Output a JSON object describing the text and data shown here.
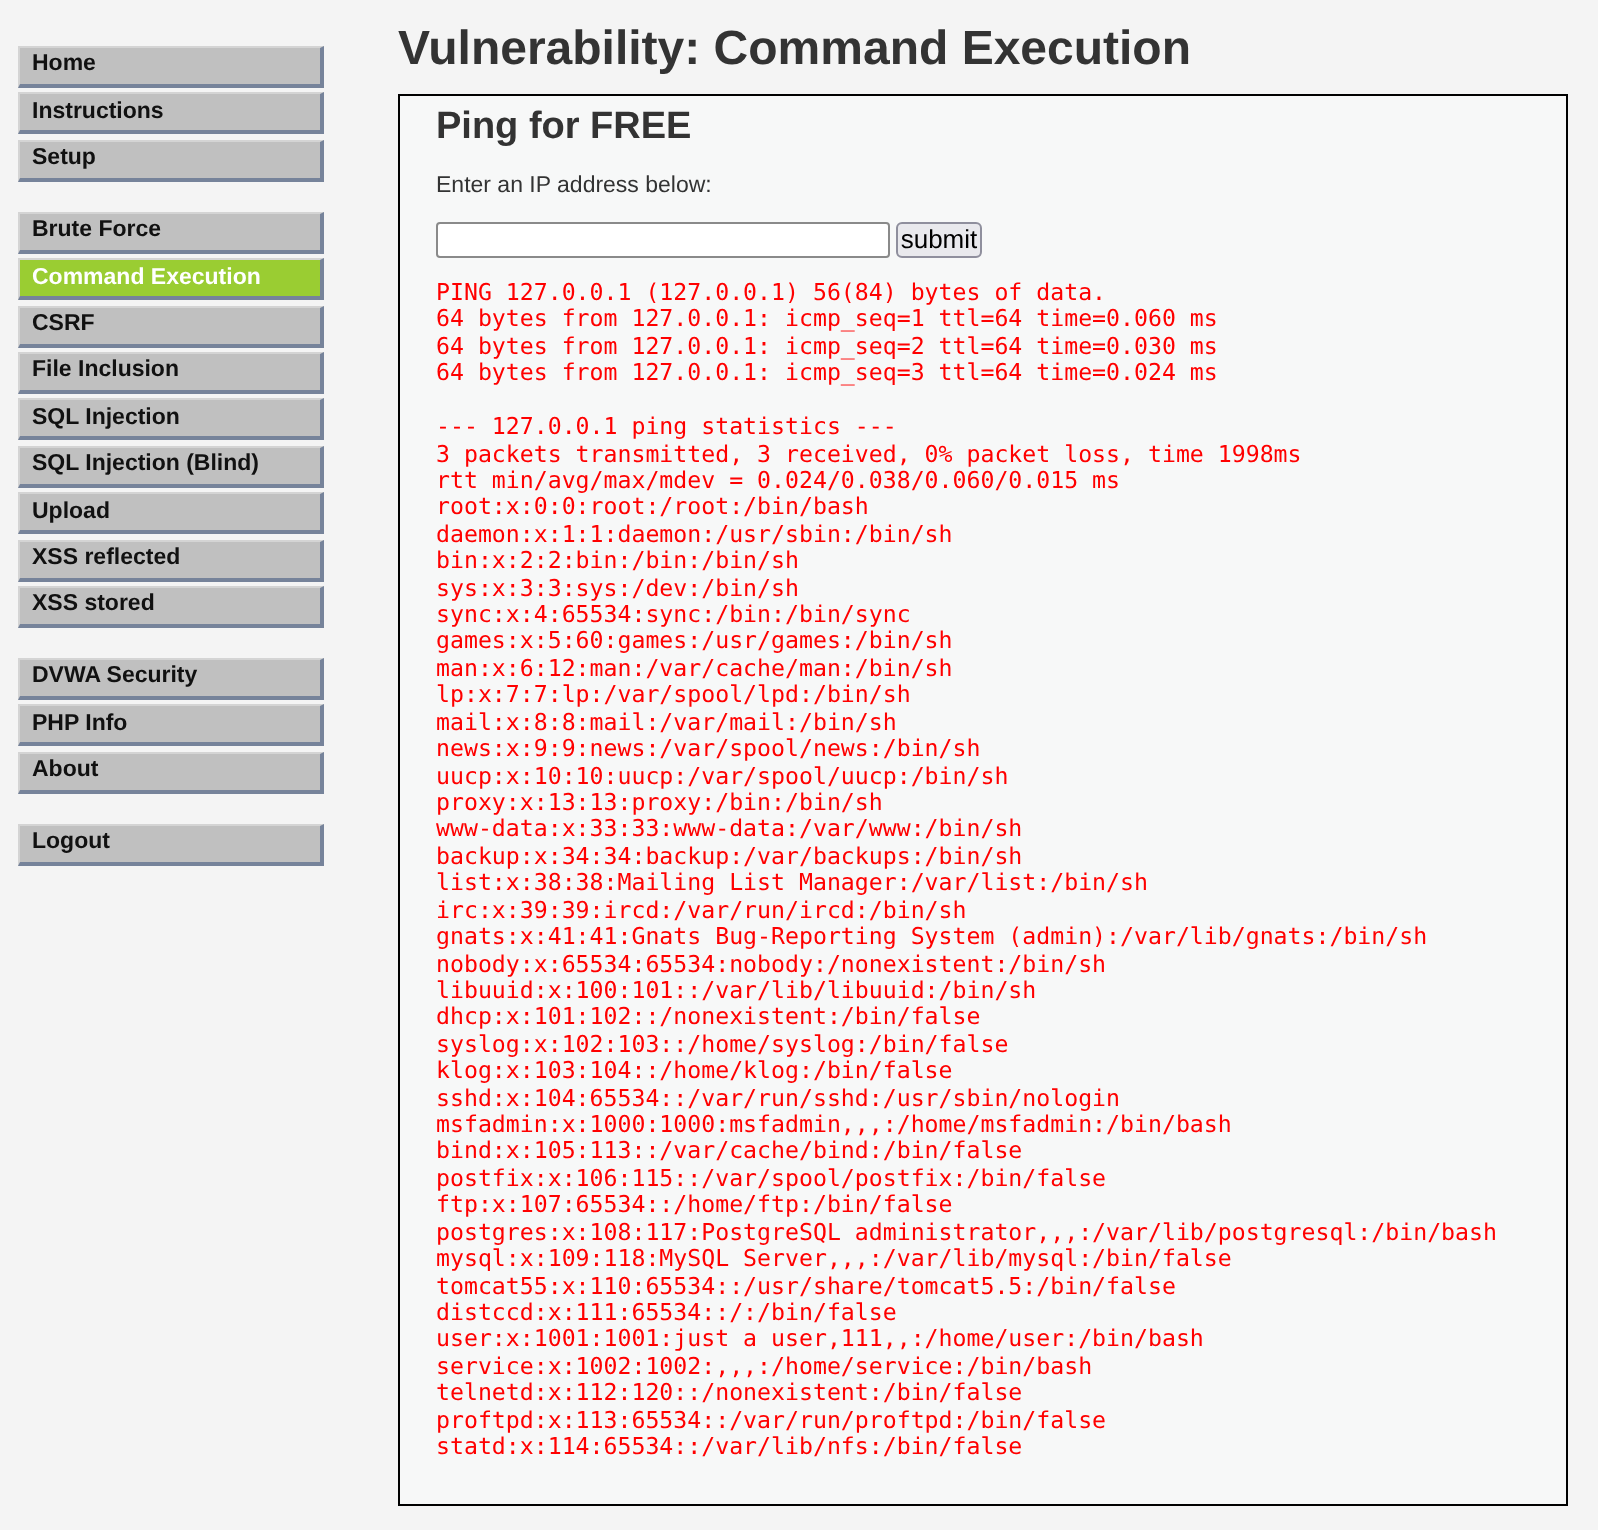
{
  "sidebar": {
    "groups": [
      {
        "items": [
          {
            "label": "Home",
            "selected": false
          },
          {
            "label": "Instructions",
            "selected": false
          },
          {
            "label": "Setup",
            "selected": false
          }
        ]
      },
      {
        "items": [
          {
            "label": "Brute Force",
            "selected": false
          },
          {
            "label": "Command Execution",
            "selected": true
          },
          {
            "label": "CSRF",
            "selected": false
          },
          {
            "label": "File Inclusion",
            "selected": false
          },
          {
            "label": "SQL Injection",
            "selected": false
          },
          {
            "label": "SQL Injection (Blind)",
            "selected": false
          },
          {
            "label": "Upload",
            "selected": false
          },
          {
            "label": "XSS reflected",
            "selected": false
          },
          {
            "label": "XSS stored",
            "selected": false
          }
        ]
      },
      {
        "items": [
          {
            "label": "DVWA Security",
            "selected": false
          },
          {
            "label": "PHP Info",
            "selected": false
          },
          {
            "label": "About",
            "selected": false
          }
        ]
      },
      {
        "items": [
          {
            "label": "Logout",
            "selected": false
          }
        ]
      }
    ]
  },
  "page_title": "Vulnerability: Command Execution",
  "panel": {
    "heading": "Ping for FREE",
    "prompt": "Enter an IP address below:",
    "submit_button": "submit",
    "output": [
      {
        "lines": [
          "PING 127.0.0.1 (127.0.0.1) 56(84) bytes of data.",
          "64 bytes from 127.0.0.1: icmp_seq=1 ttl=64 time=0.060 ms",
          "64 bytes from 127.0.0.1: icmp_seq=2 ttl=64 time=0.030 ms",
          "64 bytes from 127.0.0.1: icmp_seq=3 ttl=64 time=0.024 ms"
        ]
      },
      {
        "lines": [
          "--- 127.0.0.1 ping statistics ---",
          "3 packets transmitted, 3 received, 0% packet loss, time 1998ms",
          "rtt min/avg/max/mdev = 0.024/0.038/0.060/0.015 ms",
          "root:x:0:0:root:/root:/bin/bash",
          "daemon:x:1:1:daemon:/usr/sbin:/bin/sh",
          "bin:x:2:2:bin:/bin:/bin/sh",
          "sys:x:3:3:sys:/dev:/bin/sh",
          "sync:x:4:65534:sync:/bin:/bin/sync",
          "games:x:5:60:games:/usr/games:/bin/sh",
          "man:x:6:12:man:/var/cache/man:/bin/sh",
          "lp:x:7:7:lp:/var/spool/lpd:/bin/sh",
          "mail:x:8:8:mail:/var/mail:/bin/sh",
          "news:x:9:9:news:/var/spool/news:/bin/sh",
          "uucp:x:10:10:uucp:/var/spool/uucp:/bin/sh",
          "proxy:x:13:13:proxy:/bin:/bin/sh",
          "www-data:x:33:33:www-data:/var/www:/bin/sh",
          "backup:x:34:34:backup:/var/backups:/bin/sh",
          "list:x:38:38:Mailing List Manager:/var/list:/bin/sh",
          "irc:x:39:39:ircd:/var/run/ircd:/bin/sh",
          "gnats:x:41:41:Gnats Bug-Reporting System (admin):/var/lib/gnats:/bin/sh",
          "nobody:x:65534:65534:nobody:/nonexistent:/bin/sh",
          "libuuid:x:100:101::/var/lib/libuuid:/bin/sh",
          "dhcp:x:101:102::/nonexistent:/bin/false",
          "syslog:x:102:103::/home/syslog:/bin/false",
          "klog:x:103:104::/home/klog:/bin/false",
          "sshd:x:104:65534::/var/run/sshd:/usr/sbin/nologin",
          "msfadmin:x:1000:1000:msfadmin,,,:/home/msfadmin:/bin/bash",
          "bind:x:105:113::/var/cache/bind:/bin/false",
          "postfix:x:106:115::/var/spool/postfix:/bin/false",
          "ftp:x:107:65534::/home/ftp:/bin/false",
          "postgres:x:108:117:PostgreSQL administrator,,,:/var/lib/postgresql:/bin/bash",
          "mysql:x:109:118:MySQL Server,,,:/var/lib/mysql:/bin/false",
          "tomcat55:x:110:65534::/usr/share/tomcat5.5:/bin/false",
          "distccd:x:111:65534::/:/bin/false",
          "user:x:1001:1001:just a user,111,,:/home/user:/bin/bash",
          "service:x:1002:1002:,,,:/home/service:/bin/bash",
          "telnetd:x:112:120::/nonexistent:/bin/false",
          "proftpd:x:113:65534::/var/run/proftpd:/bin/false",
          "statd:x:114:65534::/var/lib/nfs:/bin/false"
        ]
      }
    ]
  }
}
